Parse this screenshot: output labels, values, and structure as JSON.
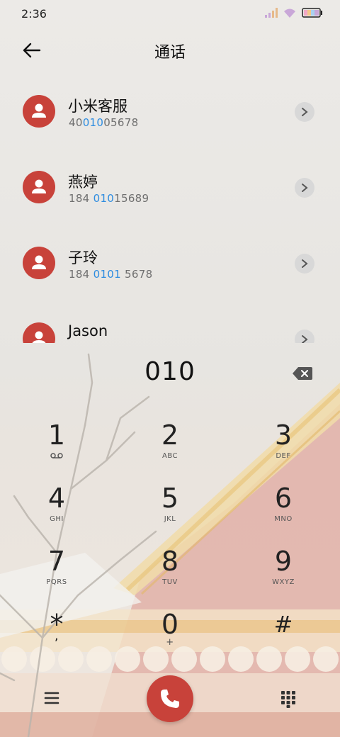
{
  "status_bar": {
    "time": "2:36",
    "icons": [
      "signal-icon",
      "wifi-icon",
      "battery-icon"
    ]
  },
  "header": {
    "title": "通话",
    "back_icon": "arrow-left-icon"
  },
  "contacts": [
    {
      "name": "小米客服",
      "number_parts": [
        "40",
        "010",
        "05678"
      ]
    },
    {
      "name": "燕婷",
      "number_parts": [
        "184 ",
        "010",
        "15689"
      ]
    },
    {
      "name": "子玲",
      "number_parts": [
        "184 ",
        "0101",
        " 5678"
      ]
    },
    {
      "name": "Jason",
      "number_parts": [
        "",
        "",
        ""
      ]
    }
  ],
  "dialer": {
    "entered_digits": "010",
    "backspace_icon": "backspace-icon",
    "keys": [
      {
        "digit": "1",
        "letters": ""
      },
      {
        "digit": "2",
        "letters": "ABC"
      },
      {
        "digit": "3",
        "letters": "DEF"
      },
      {
        "digit": "4",
        "letters": "GHI"
      },
      {
        "digit": "5",
        "letters": "JKL"
      },
      {
        "digit": "6",
        "letters": "MNO"
      },
      {
        "digit": "7",
        "letters": "PQRS"
      },
      {
        "digit": "8",
        "letters": "TUV"
      },
      {
        "digit": "9",
        "letters": "WXYZ"
      },
      {
        "digit": "*",
        "letters": ","
      },
      {
        "digit": "0",
        "letters": "+"
      },
      {
        "digit": "#",
        "letters": ""
      }
    ]
  },
  "bottom_bar": {
    "menu_icon": "menu-icon",
    "call_icon": "phone-icon",
    "dialpad_icon": "dialpad-icon"
  },
  "colors": {
    "accent": "#c8423a",
    "highlight": "#2d8ce0"
  }
}
